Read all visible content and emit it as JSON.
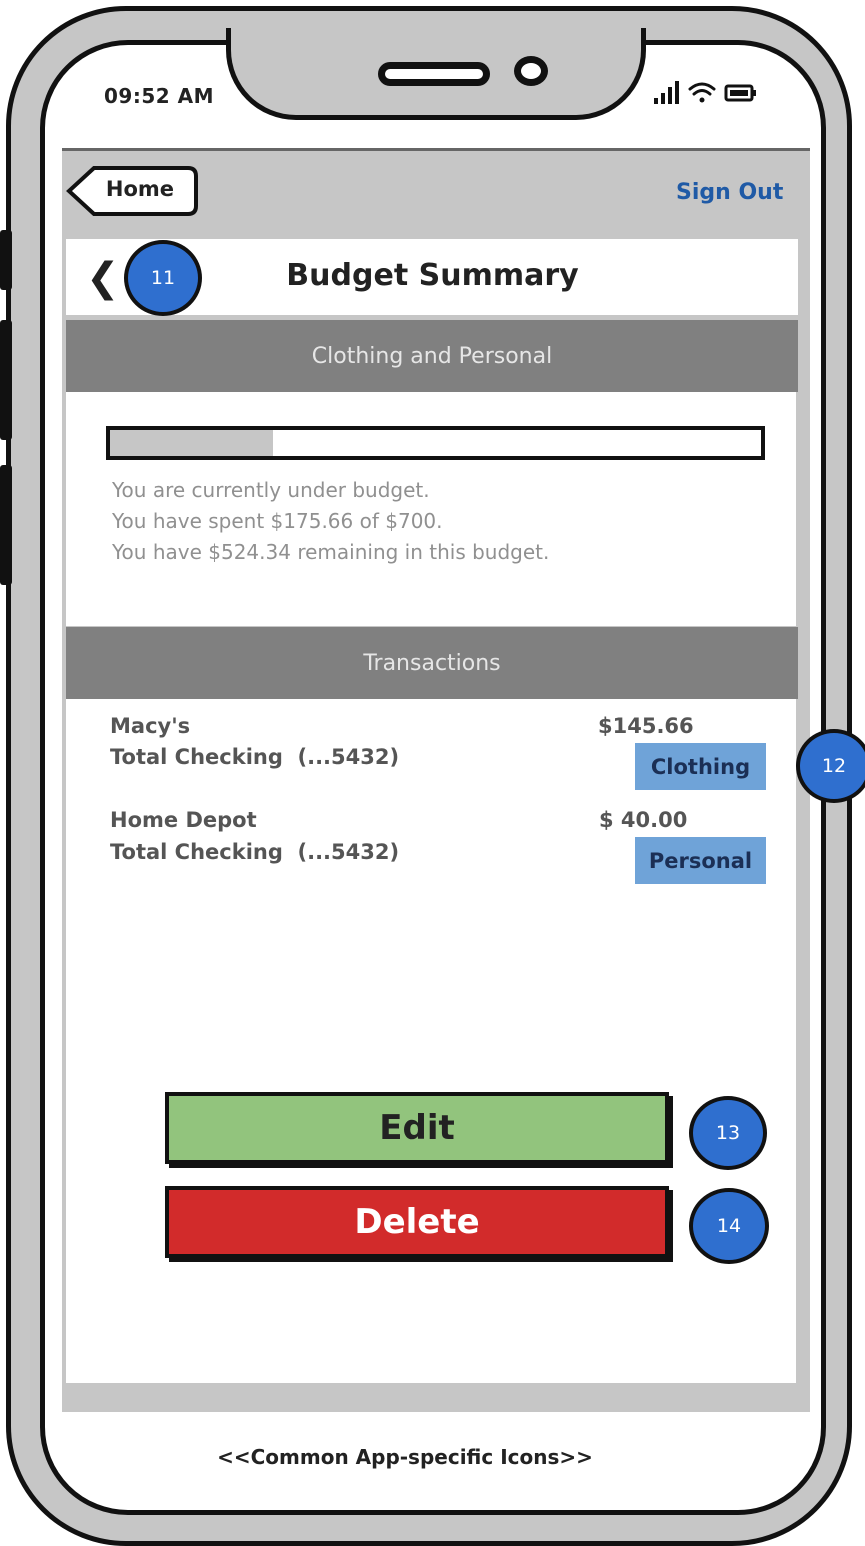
{
  "status": {
    "time": "09:52 AM"
  },
  "nav": {
    "home_label": "Home",
    "signout_label": "Sign Out"
  },
  "header": {
    "title": "Budget Summary"
  },
  "budget": {
    "category": "Clothing and Personal",
    "spent_fraction": 0.2509,
    "lines": [
      "You are currently under budget.",
      "You have spent $175.66 of $700.",
      "You have $524.34 remaining in this budget."
    ]
  },
  "transactions": {
    "header": "Transactions",
    "items": [
      {
        "merchant": "Macy's",
        "account": "Total Checking  (...5432)",
        "amount": "$145.66",
        "tag": "Clothing"
      },
      {
        "merchant": "Home Depot",
        "account": "Total Checking  (...5432)",
        "amount": "$ 40.00",
        "tag": "Personal"
      }
    ]
  },
  "actions": {
    "edit_label": "Edit",
    "delete_label": "Delete",
    "edit_color": "#92c47d",
    "delete_color": "#d22b2b"
  },
  "annotations": [
    "11",
    "12",
    "13",
    "14"
  ],
  "footer": {
    "text": "<<Common App-specific Icons>>"
  },
  "icons": [
    "signal-icon",
    "wifi-icon",
    "battery-icon",
    "chevron-left-icon"
  ]
}
